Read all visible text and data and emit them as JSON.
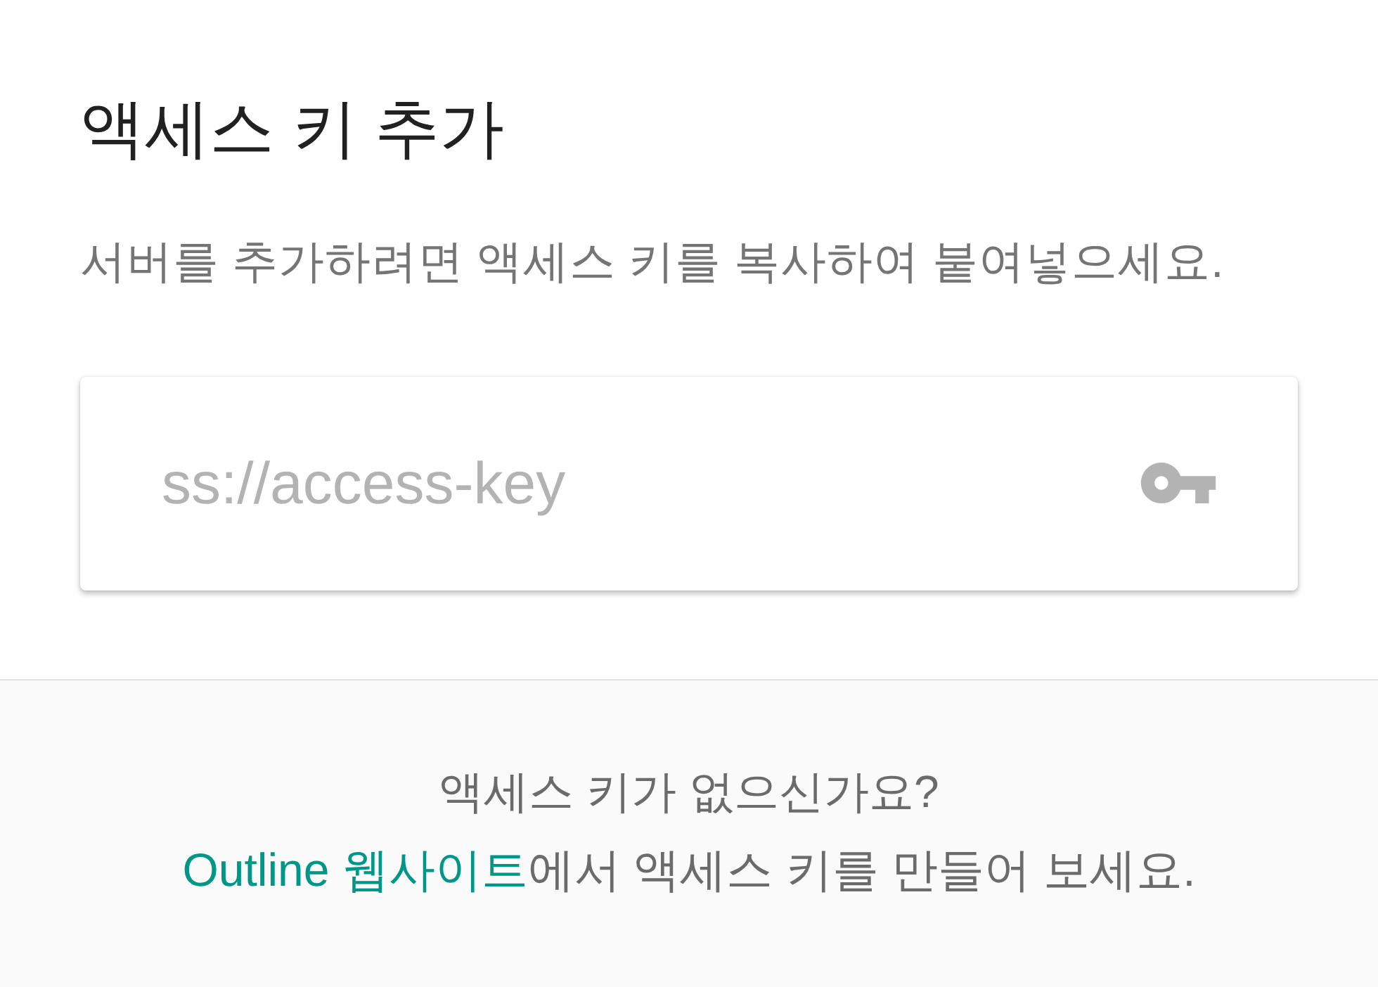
{
  "dialog": {
    "title": "액세스 키 추가",
    "description": "서버를 추가하려면 액세스 키를 복사하여 붙여넣으세요.",
    "access_key_field": {
      "placeholder": "ss://access-key"
    },
    "footer": {
      "question": "액세스 키가 없으신가요?",
      "link": "Outline 웹사이트",
      "suffix": "에서 액세스 키를 만들어 보세요."
    }
  }
}
